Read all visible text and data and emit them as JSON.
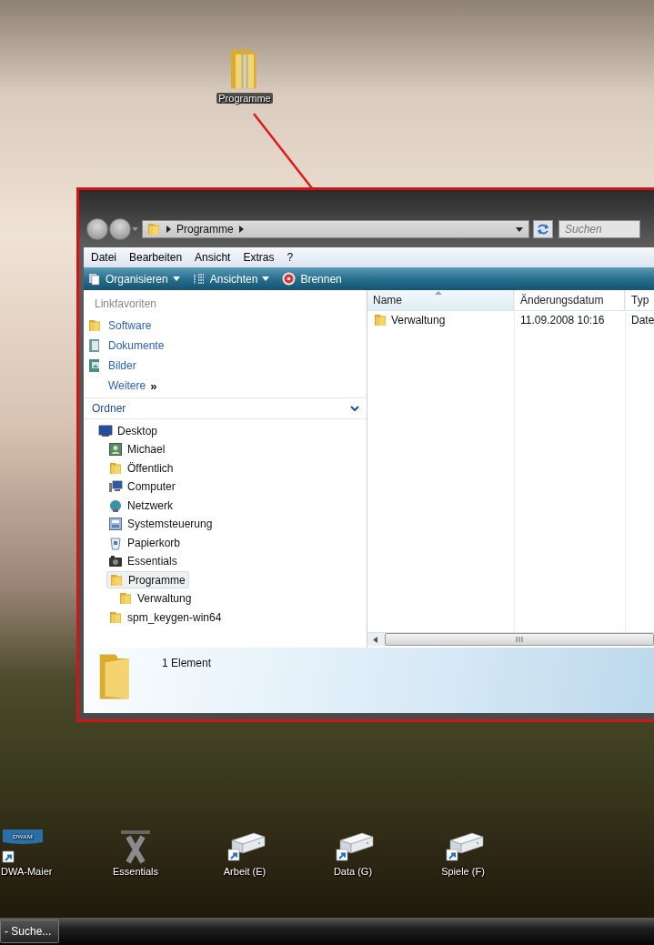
{
  "desktop": {
    "top_icons": [
      {
        "label": "Programme",
        "kind": "folder"
      }
    ],
    "bottom_icons": [
      {
        "label": "DWA-Maier",
        "kind": "logo-shortcut",
        "logo_text": "DWAM"
      },
      {
        "label": "Essentials",
        "kind": "app"
      },
      {
        "label": "Arbeit (E)",
        "kind": "drive-shortcut"
      },
      {
        "label": "Data (G)",
        "kind": "drive-shortcut"
      },
      {
        "label": "Spiele (F)",
        "kind": "drive-shortcut"
      }
    ]
  },
  "window": {
    "address": {
      "segments": [
        "Programme"
      ]
    },
    "search": {
      "placeholder": "Suchen"
    },
    "menu": [
      "Datei",
      "Bearbeiten",
      "Ansicht",
      "Extras",
      "?"
    ],
    "toolbar": [
      {
        "label": "Organisieren",
        "kind": "organize",
        "dropdown": true
      },
      {
        "label": "Ansichten",
        "kind": "views",
        "dropdown": true
      },
      {
        "label": "Brennen",
        "kind": "burn",
        "dropdown": false
      }
    ],
    "favorites": {
      "title": "Linkfavoriten",
      "items": [
        {
          "label": "Software",
          "kind": "folder"
        },
        {
          "label": "Dokumente",
          "kind": "documents"
        },
        {
          "label": "Bilder",
          "kind": "pictures"
        }
      ],
      "more": {
        "label": "Weitere",
        "chevron": "»"
      }
    },
    "folders": {
      "title": "Ordner",
      "expanded": true,
      "tree": [
        {
          "label": "Desktop",
          "kind": "desktop",
          "selected": false,
          "children": [
            {
              "label": "Michael",
              "kind": "user",
              "selected": false
            },
            {
              "label": "Öffentlich",
              "kind": "folder",
              "selected": false
            },
            {
              "label": "Computer",
              "kind": "computer",
              "selected": false
            },
            {
              "label": "Netzwerk",
              "kind": "network",
              "selected": false
            },
            {
              "label": "Systemsteuerung",
              "kind": "control-panel",
              "selected": false
            },
            {
              "label": "Papierkorb",
              "kind": "recycle-bin",
              "selected": false
            },
            {
              "label": "Essentials",
              "kind": "app",
              "selected": false
            },
            {
              "label": "Programme",
              "kind": "folder",
              "selected": true,
              "children": [
                {
                  "label": "Verwaltung",
                  "kind": "folder",
                  "selected": false
                }
              ]
            },
            {
              "label": "spm_keygen-win64",
              "kind": "folder",
              "selected": false
            }
          ]
        }
      ]
    },
    "file_list": {
      "columns": [
        {
          "label": "Name",
          "sorted": true
        },
        {
          "label": "Änderungsdatum",
          "sorted": false
        },
        {
          "label": "Typ",
          "sorted": false
        }
      ],
      "rows": [
        {
          "kind": "folder",
          "cells": [
            "Verwaltung",
            "11.09.2008 10:16",
            "Date"
          ]
        }
      ]
    },
    "details": {
      "text": "1 Element"
    }
  },
  "taskbar": {
    "buttons": [
      {
        "label": "- Suche..."
      }
    ]
  }
}
